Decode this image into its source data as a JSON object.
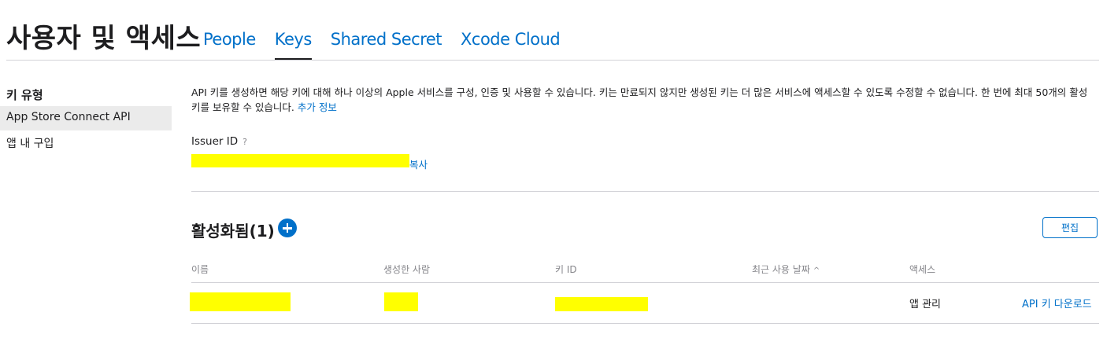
{
  "header": {
    "title": "사용자 및 액세스",
    "tabs": [
      {
        "label": "People",
        "active": false
      },
      {
        "label": "Keys",
        "active": true
      },
      {
        "label": "Shared Secret",
        "active": false
      },
      {
        "label": "Xcode Cloud",
        "active": false
      }
    ]
  },
  "sidebar": {
    "heading": "키 유형",
    "items": [
      {
        "label": "App Store Connect API",
        "selected": true
      },
      {
        "label": "앱 내 구입",
        "selected": false
      }
    ]
  },
  "main": {
    "description": "API 키를 생성하면 해당 키에 대해 하나 이상의 Apple 서비스를 구성, 인증 및 사용할 수 있습니다. 키는 만료되지 않지만 생성된 키는 더 많은 서비스에 액세스할 수 있도록 수정할 수 없습니다. 한 번에 최대 50개의 활성 키를 보유할 수 있습니다.",
    "more_info": "추가 정보",
    "issuer_label": "Issuer ID",
    "help_icon": "?",
    "copy_label": "복사",
    "section_title": "활성화됨(1)",
    "edit_label": "편집",
    "table": {
      "headers": [
        "이름",
        "생성한 사람",
        "키 ID",
        "최근 사용 날짜",
        "액세스"
      ],
      "sort_icon": "^",
      "rows": [
        {
          "access": "앱 관리",
          "download": "API 키 다운로드"
        }
      ]
    }
  },
  "colors": {
    "accent": "#0070c9",
    "redaction": "#ffff00",
    "divider": "#d2d2d7"
  }
}
